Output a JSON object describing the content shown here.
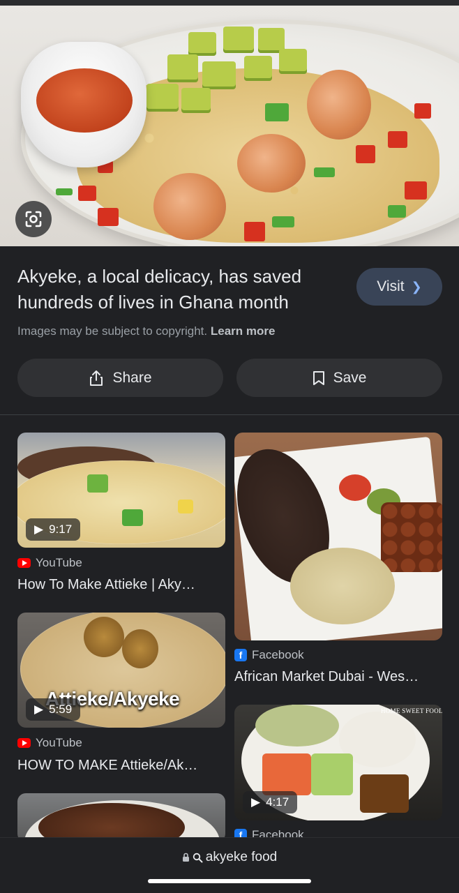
{
  "hero": {
    "lens_icon": "lens-camera-icon"
  },
  "result": {
    "title": "Akyeke, a local delicacy, has saved hundreds of lives in Ghana month",
    "visit_label": "Visit",
    "copyright_text": "Images may be subject to copyright.",
    "learn_more_label": "Learn more",
    "share_label": "Share",
    "save_label": "Save"
  },
  "related": [
    {
      "duration": "9:17",
      "source": "YouTube",
      "source_icon": "youtube-icon",
      "title": "How To Make Attieke | Aky…"
    },
    {
      "duration": "",
      "source": "Facebook",
      "source_icon": "facebook-icon",
      "title": "African Market Dubai - Wes…"
    },
    {
      "duration": "5:59",
      "source": "YouTube",
      "source_icon": "youtube-icon",
      "title": "HOW TO MAKE Attieke/Ak…",
      "overlay_text": "Attieke/Akyeke"
    },
    {
      "duration": "4:17",
      "source": "Facebook",
      "source_icon": "facebook-icon",
      "title": "",
      "overlay_text": "HOME SWEET FOOD"
    }
  ],
  "browser": {
    "url": "akyeke food"
  }
}
